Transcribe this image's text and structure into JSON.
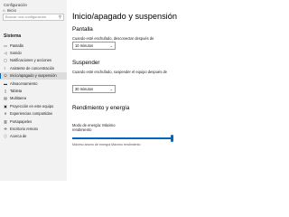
{
  "window": {
    "title": "Configuración"
  },
  "sidebar": {
    "home_label": "Inicio",
    "search_placeholder": "Buscar una configuración",
    "section": "Sistema",
    "items": [
      {
        "label": "Pantalla",
        "icon": "display-icon"
      },
      {
        "label": "Sonido",
        "icon": "speaker-icon"
      },
      {
        "label": "Notificaciones y acciones",
        "icon": "notifications-icon"
      },
      {
        "label": "Asistente de concentración",
        "icon": "moon-icon"
      },
      {
        "label": "Inicio/apagado y suspensión",
        "icon": "power-icon",
        "selected": true
      },
      {
        "label": "Almacenamiento",
        "icon": "storage-icon"
      },
      {
        "label": "Tableta",
        "icon": "tablet-icon"
      },
      {
        "label": "Multitarea",
        "icon": "multitask-icon"
      },
      {
        "label": "Proyección en este equipo",
        "icon": "project-icon"
      },
      {
        "label": "Experiencias compartidas",
        "icon": "share-icon"
      },
      {
        "label": "Portapapeles",
        "icon": "clipboard-icon"
      },
      {
        "label": "Escritorio remoto",
        "icon": "remote-icon"
      },
      {
        "label": "Acerca de",
        "icon": "info-icon"
      }
    ]
  },
  "main": {
    "title": "Inicio/apagado y suspensión",
    "screen": {
      "heading": "Pantalla",
      "label": "Cuando esté enchufado, desconectar después de",
      "value": "10 minutos"
    },
    "sleep": {
      "heading": "Suspender",
      "label": "Cuando esté enchufado, suspender el equipo después de",
      "value": "30 minutos"
    },
    "performance": {
      "heading": "Rendimiento y energía",
      "mode_label": "Modo de energía: Máximo rendimiento",
      "mode_level": 1.0,
      "slider_note": "Máximo ahorro de energía     Máximo rendimiento"
    }
  },
  "colors": {
    "accent": "#0067c0",
    "sidebar_bg": "#f2f2f2"
  }
}
